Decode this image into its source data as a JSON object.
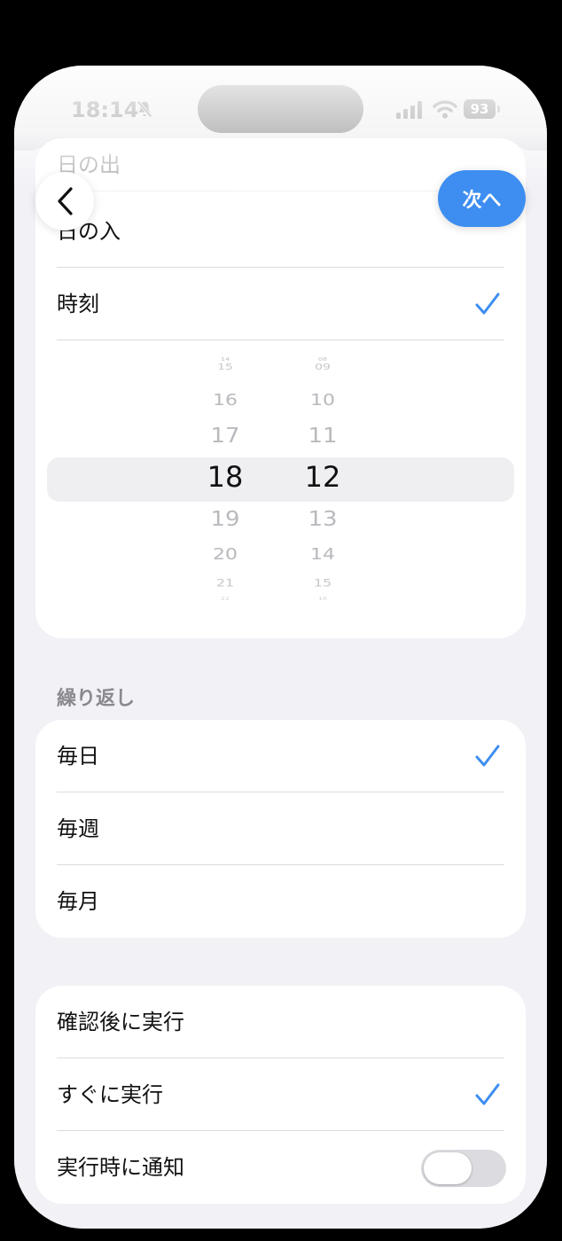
{
  "status_bar": {
    "time": "18:14",
    "battery": "93"
  },
  "nav": {
    "next_label": "次へ"
  },
  "trigger_options": [
    {
      "label": "日の出",
      "checked": false
    },
    {
      "label": "日の入",
      "checked": false
    },
    {
      "label": "時刻",
      "checked": true
    }
  ],
  "time_picker": {
    "hours": [
      "14",
      "15",
      "16",
      "17",
      "18",
      "19",
      "20",
      "21",
      "22"
    ],
    "minutes": [
      "08",
      "09",
      "10",
      "11",
      "12",
      "13",
      "14",
      "15",
      "16"
    ],
    "selected_hour": "18",
    "selected_minute": "12"
  },
  "repeat": {
    "header": "繰り返し",
    "options": [
      {
        "label": "毎日",
        "checked": true
      },
      {
        "label": "毎週",
        "checked": false
      },
      {
        "label": "毎月",
        "checked": false
      }
    ]
  },
  "run": {
    "options": [
      {
        "label": "確認後に実行",
        "checked": false
      },
      {
        "label": "すぐに実行",
        "checked": true
      }
    ],
    "notify": {
      "label": "実行時に通知",
      "on": false
    }
  },
  "colors": {
    "accent": "#3d8ef0",
    "background": "#f1f1f6"
  }
}
